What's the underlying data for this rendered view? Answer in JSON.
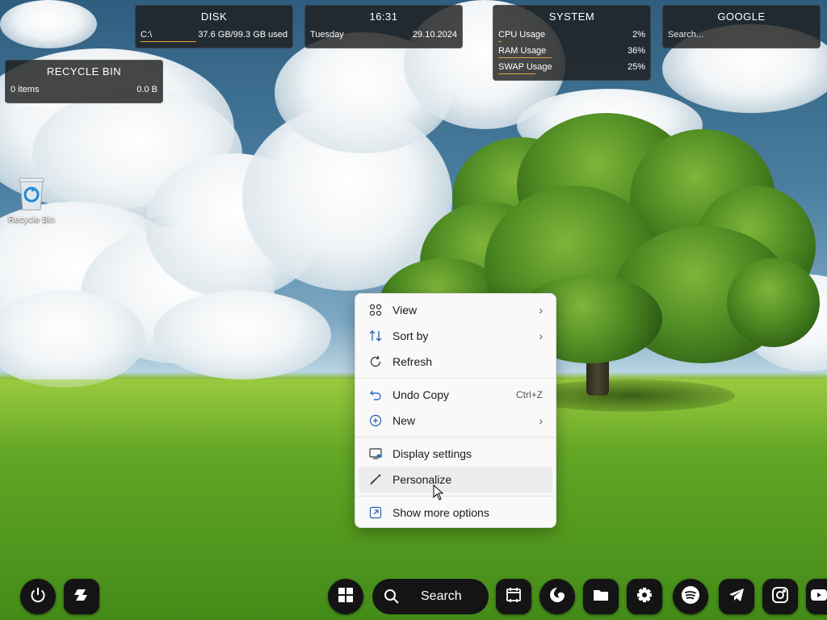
{
  "widgets": {
    "disk": {
      "title": "DISK",
      "drive": "C:\\",
      "usage": "37.6 GB/99.3 GB used",
      "fill_fraction": 0.38
    },
    "clock": {
      "time": "16:31",
      "day": "Tuesday",
      "date": "29.10.2024"
    },
    "system": {
      "title": "SYSTEM",
      "rows": [
        {
          "label": "CPU Usage",
          "value": "2%",
          "fraction": 0.02
        },
        {
          "label": "RAM Usage",
          "value": "36%",
          "fraction": 0.36
        },
        {
          "label": "SWAP Usage",
          "value": "25%",
          "fraction": 0.25
        }
      ]
    },
    "google": {
      "title": "GOOGLE",
      "placeholder": "Search..."
    },
    "recycle": {
      "title": "RECYCLE BIN",
      "items": "0 items",
      "size": "0.0 B"
    }
  },
  "desktop": {
    "recycle_bin_label": "Recycle Bin"
  },
  "context_menu": {
    "items": [
      {
        "label": "View",
        "icon": "grid-icon",
        "submenu": true
      },
      {
        "label": "Sort by",
        "icon": "sort-icon",
        "submenu": true
      },
      {
        "label": "Refresh",
        "icon": "refresh-icon"
      },
      {
        "label": "Undo Copy",
        "icon": "undo-icon",
        "shortcut": "Ctrl+Z"
      },
      {
        "label": "New",
        "icon": "plus-circle-icon",
        "submenu": true
      },
      {
        "label": "Display settings",
        "icon": "display-icon"
      },
      {
        "label": "Personalize",
        "icon": "brush-icon",
        "hovered": true
      },
      {
        "label": "Show more options",
        "icon": "more-options-icon"
      }
    ]
  },
  "taskbar": {
    "search_label": "Search",
    "left_buttons": [
      "power-icon",
      "copilot-icon"
    ],
    "right_buttons": [
      "windows-start-icon",
      "search-icon",
      "terminal-icon",
      "edge-icon",
      "folder-icon",
      "settings-gear-icon",
      "spotify-icon",
      "telegram-icon",
      "instagram-icon",
      "youtube-icon"
    ]
  },
  "colors": {
    "widget_bg": "#1e1e1e",
    "meter_accent": "#e0a63a",
    "menu_bg": "#f9f9f9",
    "taskbar_btn": "#141414"
  }
}
